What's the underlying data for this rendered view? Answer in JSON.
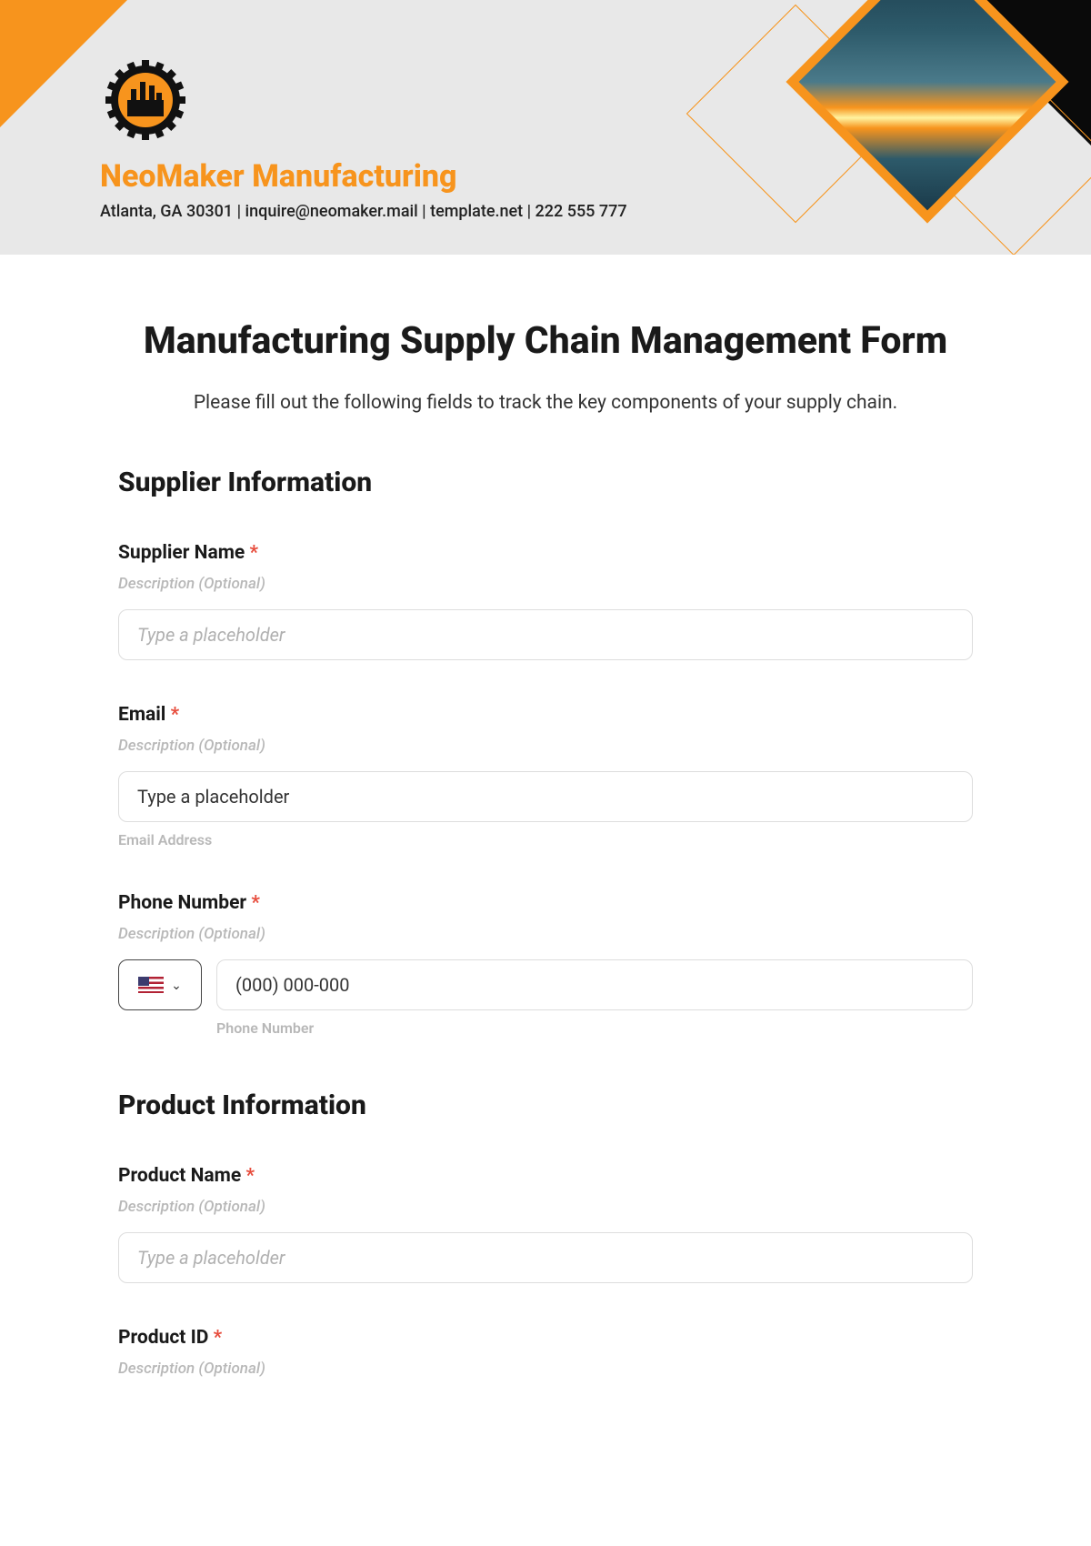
{
  "header": {
    "brand": "NeoMaker Manufacturing",
    "contact": "Atlanta, GA 30301 | inquire@neomaker.mail | template.net | 222 555 777"
  },
  "form": {
    "title": "Manufacturing Supply Chain Management Form",
    "subtitle": "Please fill out the following fields to track the key components of your supply chain.",
    "sections": {
      "supplier": {
        "heading": "Supplier Information",
        "fields": {
          "name": {
            "label": "Supplier Name",
            "required": "*",
            "desc": "Description (Optional)",
            "placeholder": "Type a placeholder"
          },
          "email": {
            "label": "Email",
            "required": "*",
            "desc": "Description (Optional)",
            "placeholder": "Type a placeholder",
            "sublabel": "Email Address"
          },
          "phone": {
            "label": "Phone Number",
            "required": "*",
            "desc": "Description (Optional)",
            "placeholder": "(000) 000-000",
            "sublabel": "Phone Number"
          }
        }
      },
      "product": {
        "heading": "Product Information",
        "fields": {
          "name": {
            "label": "Product Name",
            "required": "*",
            "desc": "Description (Optional)",
            "placeholder": "Type a placeholder"
          },
          "id": {
            "label": "Product ID",
            "required": "*",
            "desc": "Description (Optional)"
          }
        }
      }
    }
  }
}
